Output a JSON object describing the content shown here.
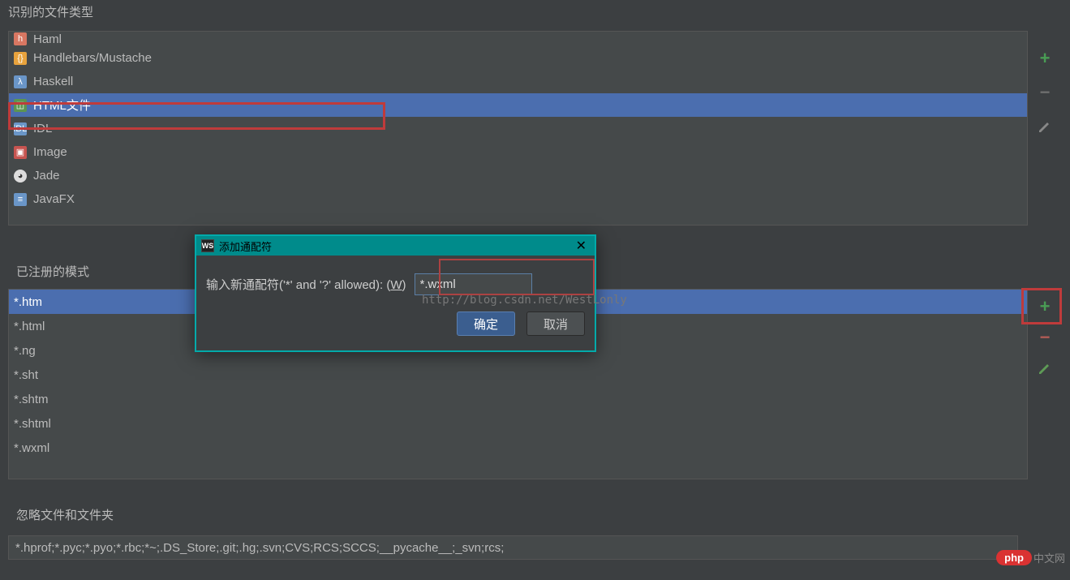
{
  "labels": {
    "recognized_file_types": "识别的文件类型",
    "registered_patterns": "已注册的模式",
    "ignore_files": "忽略文件和文件夹"
  },
  "file_types": {
    "partial_top": "Haml",
    "items": [
      "Handlebars/Mustache",
      "Haskell",
      "HTML文件",
      "IDL",
      "Image",
      "Jade",
      "JavaFX"
    ],
    "selected_index": 2
  },
  "patterns": {
    "items": [
      "*.htm",
      "*.html",
      "*.ng",
      "*.sht",
      "*.shtm",
      "*.shtml",
      "*.wxml"
    ],
    "selected_index": 0
  },
  "ignore_value": "*.hprof;*.pyc;*.pyo;*.rbc;*~;.DS_Store;.git;.hg;.svn;CVS;RCS;SCCS;__pycache__;_svn;rcs;",
  "dialog": {
    "logo": "WS",
    "title": "添加通配符",
    "label": "输入新通配符('*' and '?' allowed): (",
    "label_key": "W",
    "label_after": ")",
    "input_value": "*.wxml",
    "ok": "确定",
    "cancel": "取消"
  },
  "watermark": "http://blog.csdn.net/WestLonly",
  "badge": {
    "brand": "php",
    "site": "中文网"
  }
}
